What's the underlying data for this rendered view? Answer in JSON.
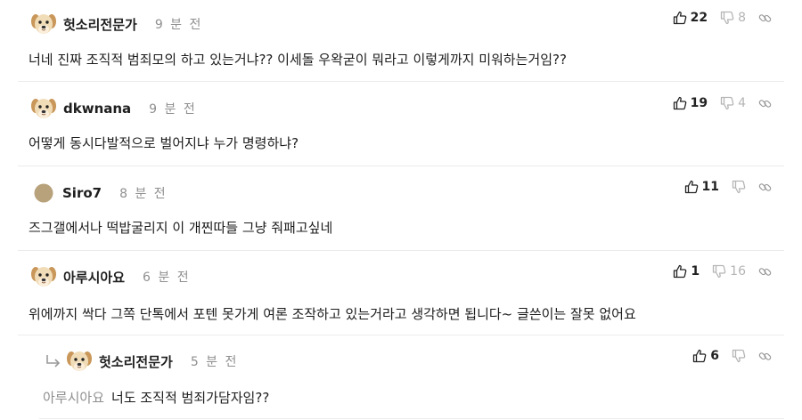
{
  "colors": {
    "text": "#1c1c1c",
    "muted": "#8f8f8f",
    "down": "#b5b5b5",
    "divider": "#ebebeb"
  },
  "comments": [
    {
      "author": "헛소리전문가",
      "time": "9 분 전",
      "avatar": "puppy-avatar",
      "likes": "22",
      "dislikes": "8",
      "text": "너네 진짜 조직적 범죄모의 하고 있는거냐?? 이세돌 우왁굳이 뭐라고 이렇게까지 미워하는거임??"
    },
    {
      "author": "dkwnana",
      "time": "9 분 전",
      "avatar": "puppy-avatar",
      "likes": "19",
      "dislikes": "4",
      "text": "어떻게 동시다발적으로 벌어지냐 누가 명령하냐?"
    },
    {
      "author": "Siro7",
      "time": "8 분 전",
      "avatar": "circle-avatar",
      "likes": "11",
      "dislikes": "",
      "text": "즈그갤에서나 떡밥굴리지 이 개찐따들 그냥 줘패고싶네"
    },
    {
      "author": "아루시아요",
      "time": "6 분 전",
      "avatar": "puppy-avatar",
      "likes": "1",
      "dislikes": "16",
      "text": "위에까지 싹다 그쪽 단톡에서 포텐 못가게 여론 조작하고 있는거라고 생각하면 됩니다~ 글쓴이는 잘못 없어요"
    }
  ],
  "reply": {
    "author": "헛소리전문가",
    "time": "5 분 전",
    "avatar": "puppy-avatar",
    "likes": "6",
    "dislikes": "",
    "mention": "아루시아요",
    "text": "너도 조직적 범죄가담자임??"
  }
}
